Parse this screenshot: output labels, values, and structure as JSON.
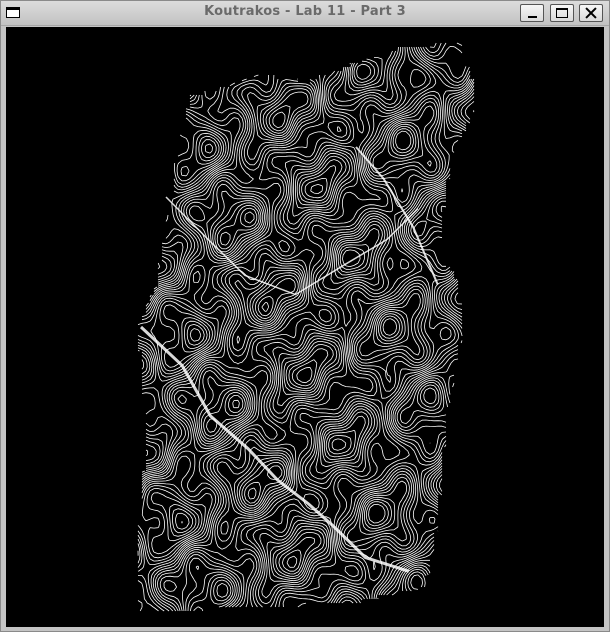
{
  "window": {
    "title": "Koutrakos - Lab 11 - Part 3"
  },
  "titlebar_buttons": {
    "minimize_icon": "minimize-icon",
    "maximize_icon": "maximize-icon",
    "close_icon": "close-icon",
    "system_menu_icon": "window-menu-icon"
  },
  "canvas": {
    "background": "#000000",
    "line_color": "#ffffff",
    "content": "white contour-line terrain rendering"
  }
}
